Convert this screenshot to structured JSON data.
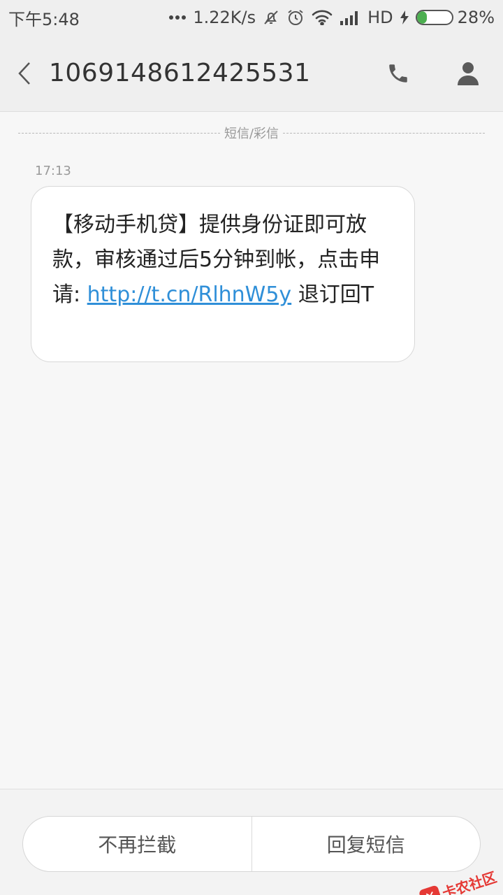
{
  "status_bar": {
    "time": "下午5:48",
    "net_speed": "1.22K/s",
    "network_type": "HD",
    "battery_percent_text": "28%",
    "battery_level": 0.28,
    "icons": [
      "dots-icon",
      "mute-bell-icon",
      "alarm-icon",
      "wifi-icon",
      "signal-icon",
      "charging-icon",
      "battery-icon"
    ]
  },
  "header": {
    "title": "1069148612425531",
    "icons": [
      "back-chevron-icon",
      "phone-icon",
      "contact-person-icon"
    ]
  },
  "conversation": {
    "divider_label": "短信/彩信",
    "messages": [
      {
        "time": "17:13",
        "text_before_link": "【移动手机贷】提供身份证即可放款，审核通过后5分钟到帐，点击申请: ",
        "link_text": "http://t.cn/RlhnW5y",
        "text_after_link": " 退订回T"
      }
    ]
  },
  "actions": {
    "unblock": "不再拦截",
    "reply": "回复短信"
  },
  "watermark": {
    "text": "卡农社区"
  },
  "colors": {
    "link": "#2f8fd8",
    "battery_fill": "#4caf50",
    "background": "#f7f7f7",
    "bar_background": "#efefef"
  }
}
